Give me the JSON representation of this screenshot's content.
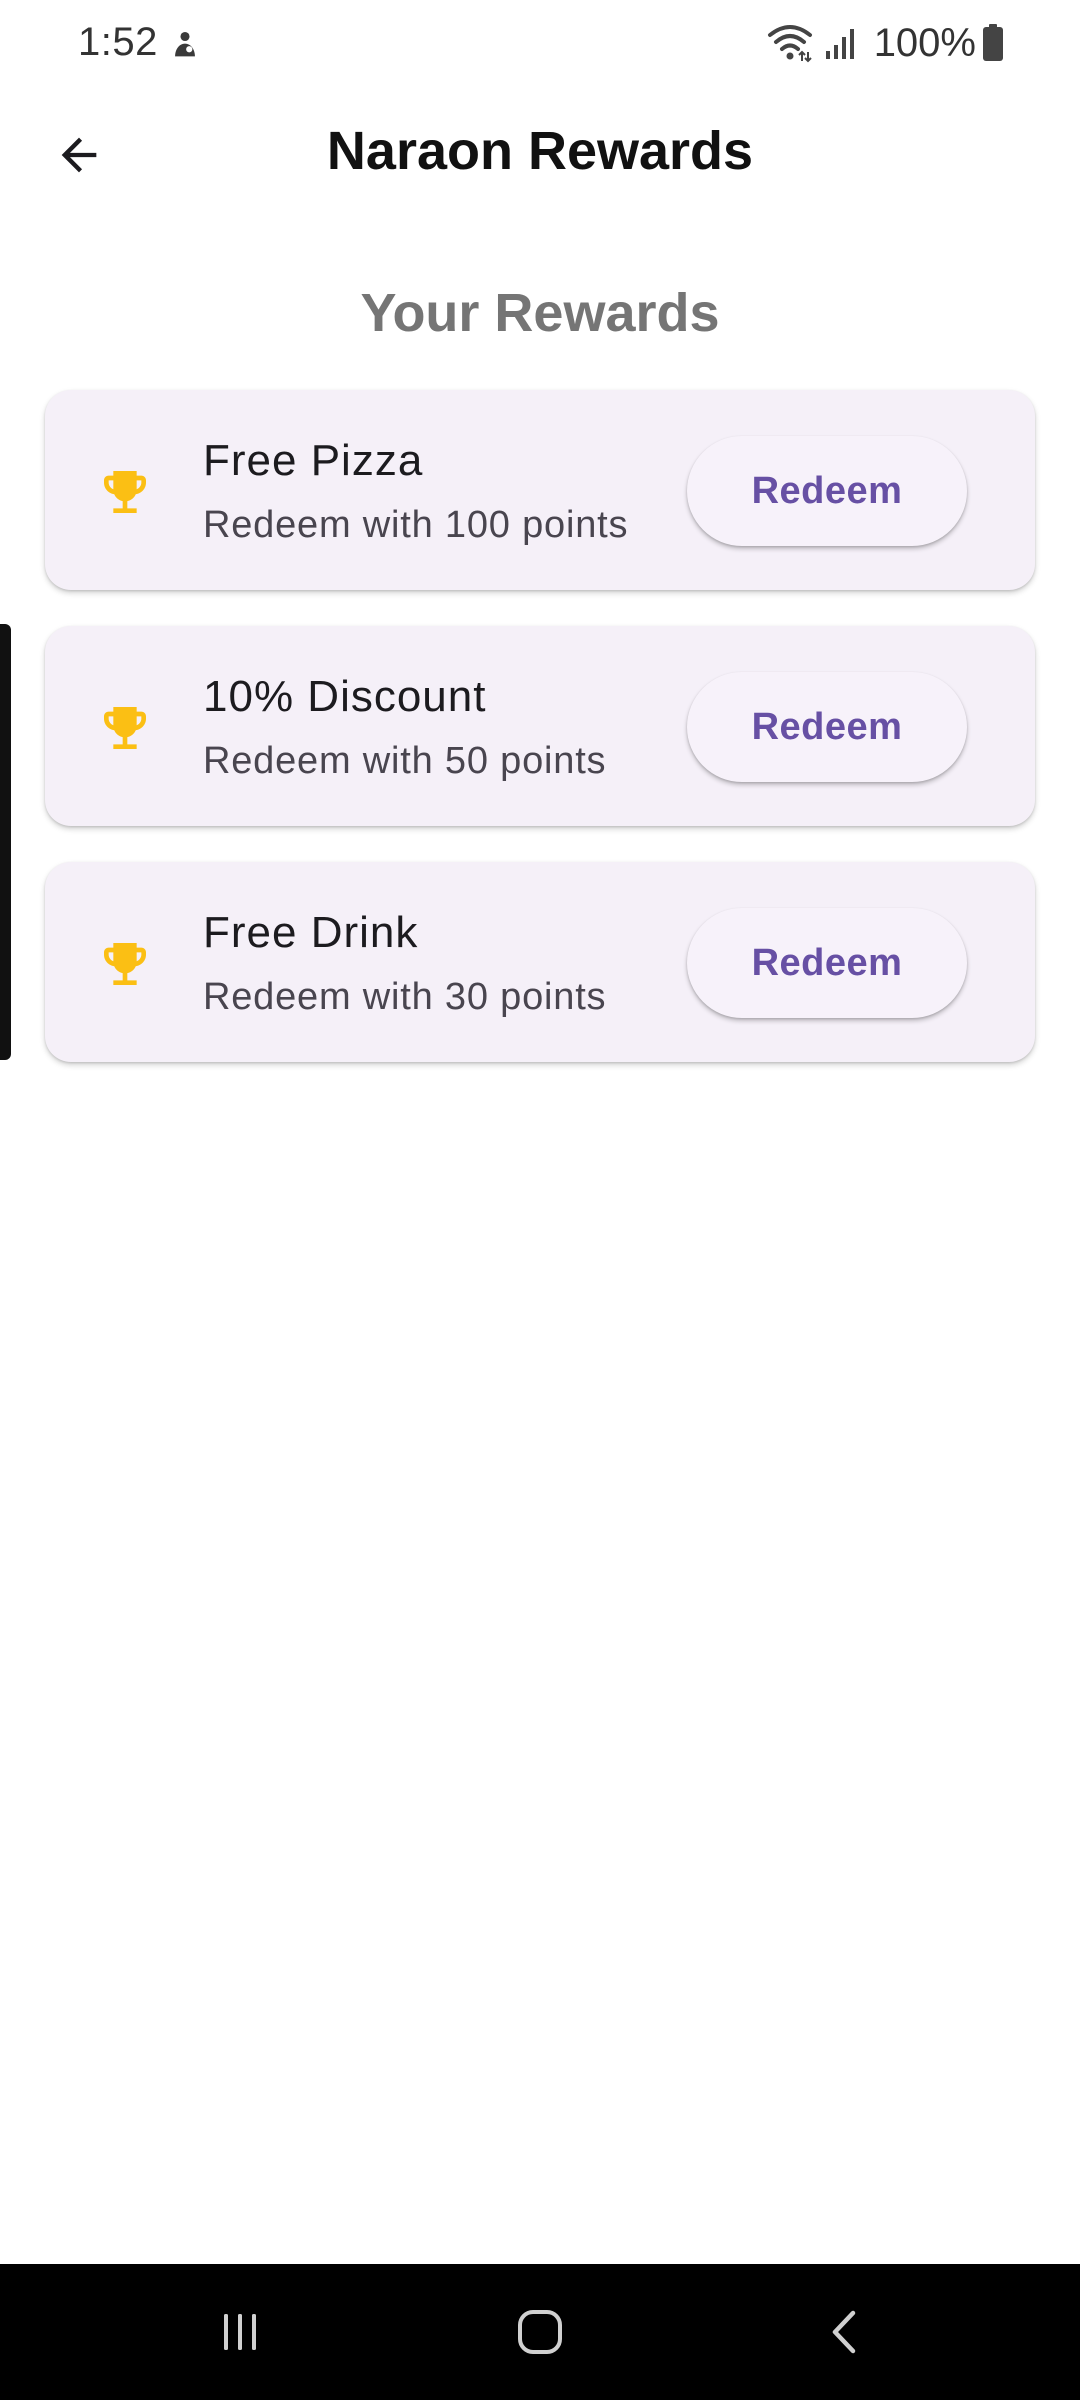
{
  "status_bar": {
    "time": "1:52",
    "battery_percent": "100%"
  },
  "app_bar": {
    "title": "Naraon Rewards"
  },
  "section_title": "Your Rewards",
  "rewards": [
    {
      "name": "Free Pizza",
      "points_text": "Redeem with 100 points",
      "button_label": "Redeem"
    },
    {
      "name": "10% Discount",
      "points_text": "Redeem with 50 points",
      "button_label": "Redeem"
    },
    {
      "name": "Free Drink",
      "points_text": "Redeem with 30 points",
      "button_label": "Redeem"
    }
  ],
  "icons": {
    "back": "arrow-back-icon",
    "reward": "trophy-icon",
    "nav_recents": "recents-icon",
    "nav_home": "home-icon",
    "nav_back": "nav-back-icon"
  },
  "colors": {
    "card_bg": "#f5f0f8",
    "accent": "#6750a4",
    "trophy": "#fbbf14",
    "heading_grey": "#757575"
  }
}
